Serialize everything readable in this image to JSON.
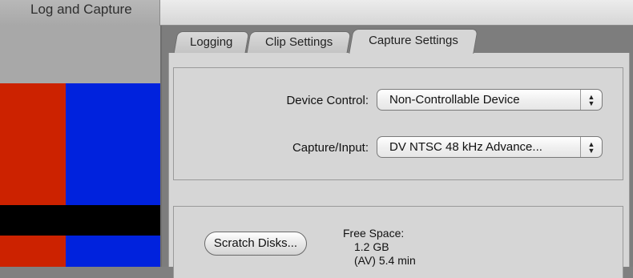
{
  "window": {
    "title": "Log and Capture"
  },
  "preview": {
    "bars": [
      {
        "name": "red-bar",
        "color": "#cc2200"
      },
      {
        "name": "blue-bar",
        "color": "#0022dd"
      },
      {
        "name": "black-band",
        "color": "#000000"
      }
    ]
  },
  "tabs": [
    {
      "label": "Logging",
      "active": false
    },
    {
      "label": "Clip Settings",
      "active": false
    },
    {
      "label": "Capture Settings",
      "active": true
    }
  ],
  "capture_settings": {
    "device_control": {
      "label": "Device Control:",
      "value": "Non-Controllable Device"
    },
    "capture_input": {
      "label": "Capture/Input:",
      "value": "DV NTSC 48 kHz Advance..."
    },
    "scratch_disks_button": "Scratch Disks...",
    "free_space": {
      "label": "Free Space:",
      "value": "1.2 GB",
      "av": "(AV) 5.4 min"
    }
  }
}
